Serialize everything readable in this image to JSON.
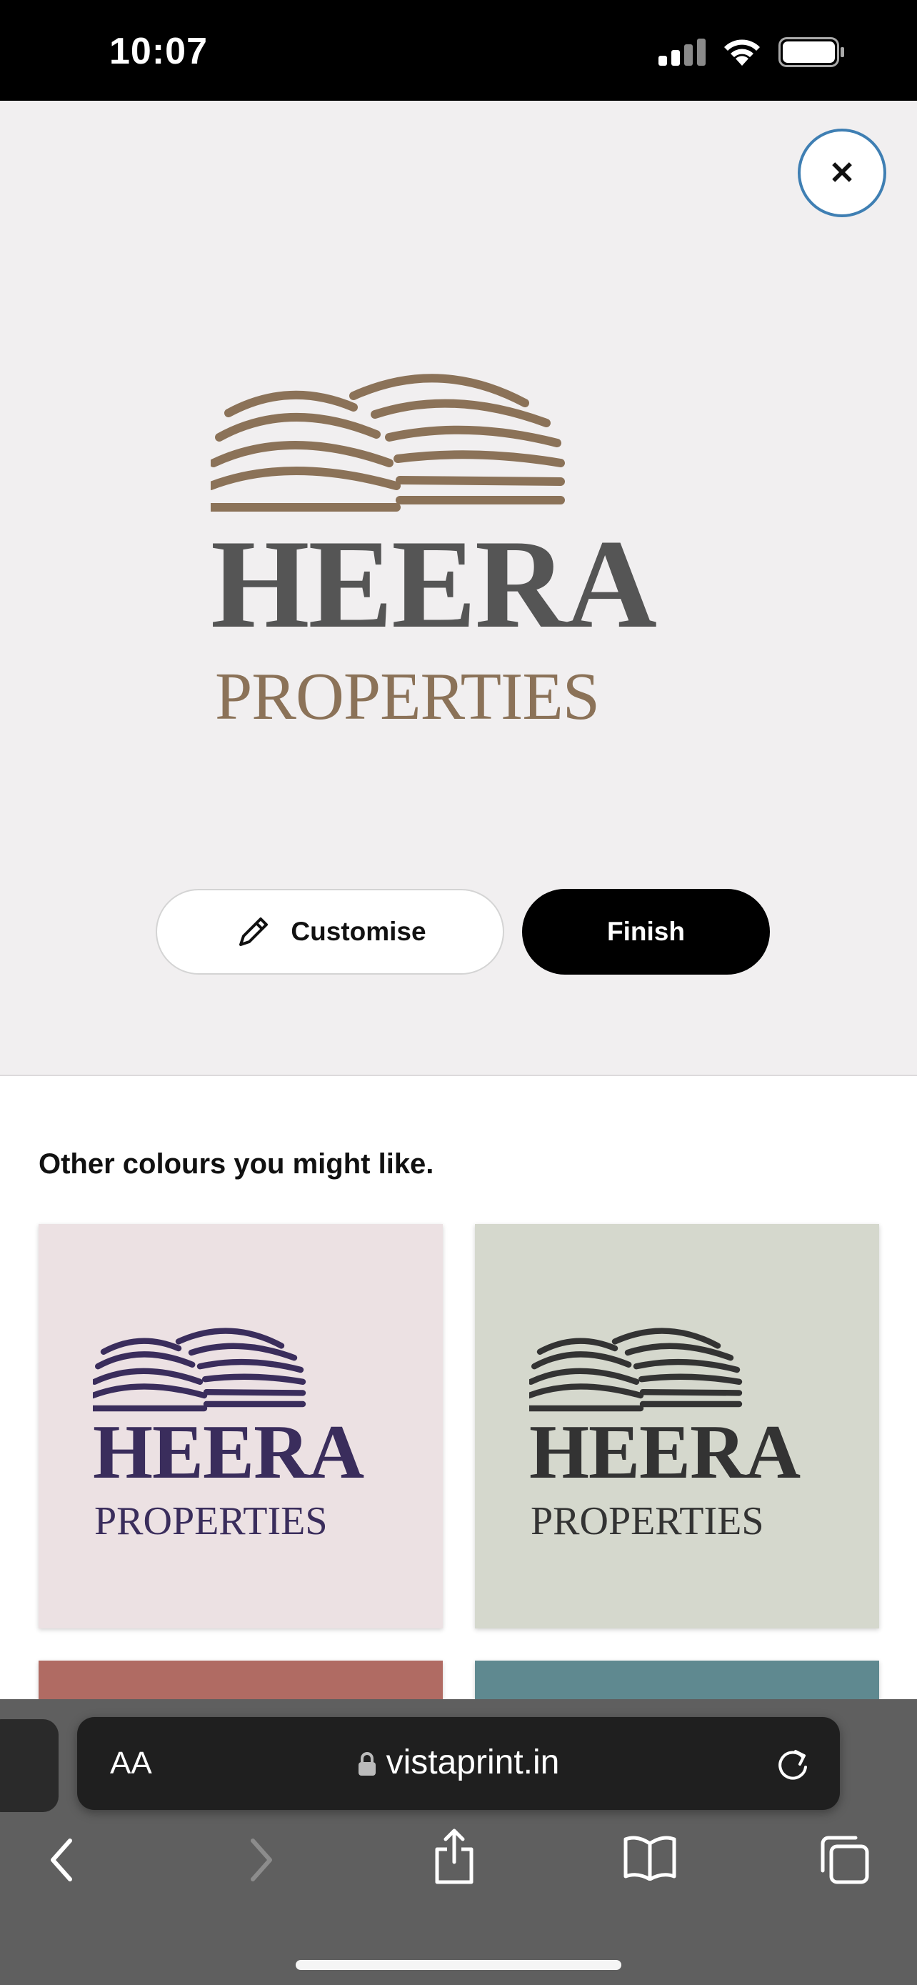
{
  "status_bar": {
    "time": "10:07"
  },
  "close_button": {
    "symbol": "✕"
  },
  "logo": {
    "word1": "HEERA",
    "word2": "PROPERTIES",
    "colors": {
      "building": "#8b7258",
      "word1": "#555555",
      "word2": "#8b7258"
    }
  },
  "actions": {
    "customise_label": "Customise",
    "finish_label": "Finish"
  },
  "suggestions": {
    "title": "Other colours you might like.",
    "cards": [
      {
        "word1": "HEERA",
        "word2": "PROPERTIES",
        "bg": "#ece1e3",
        "fg": "#3a2d5c"
      },
      {
        "word1": "HEERA",
        "word2": "PROPERTIES",
        "bg": "#d5d8cd",
        "fg": "#333333"
      }
    ],
    "peek_colors": [
      "#b06b63",
      "#5f8990"
    ]
  },
  "browser": {
    "aa_label": "AA",
    "url": "vistaprint.in"
  }
}
